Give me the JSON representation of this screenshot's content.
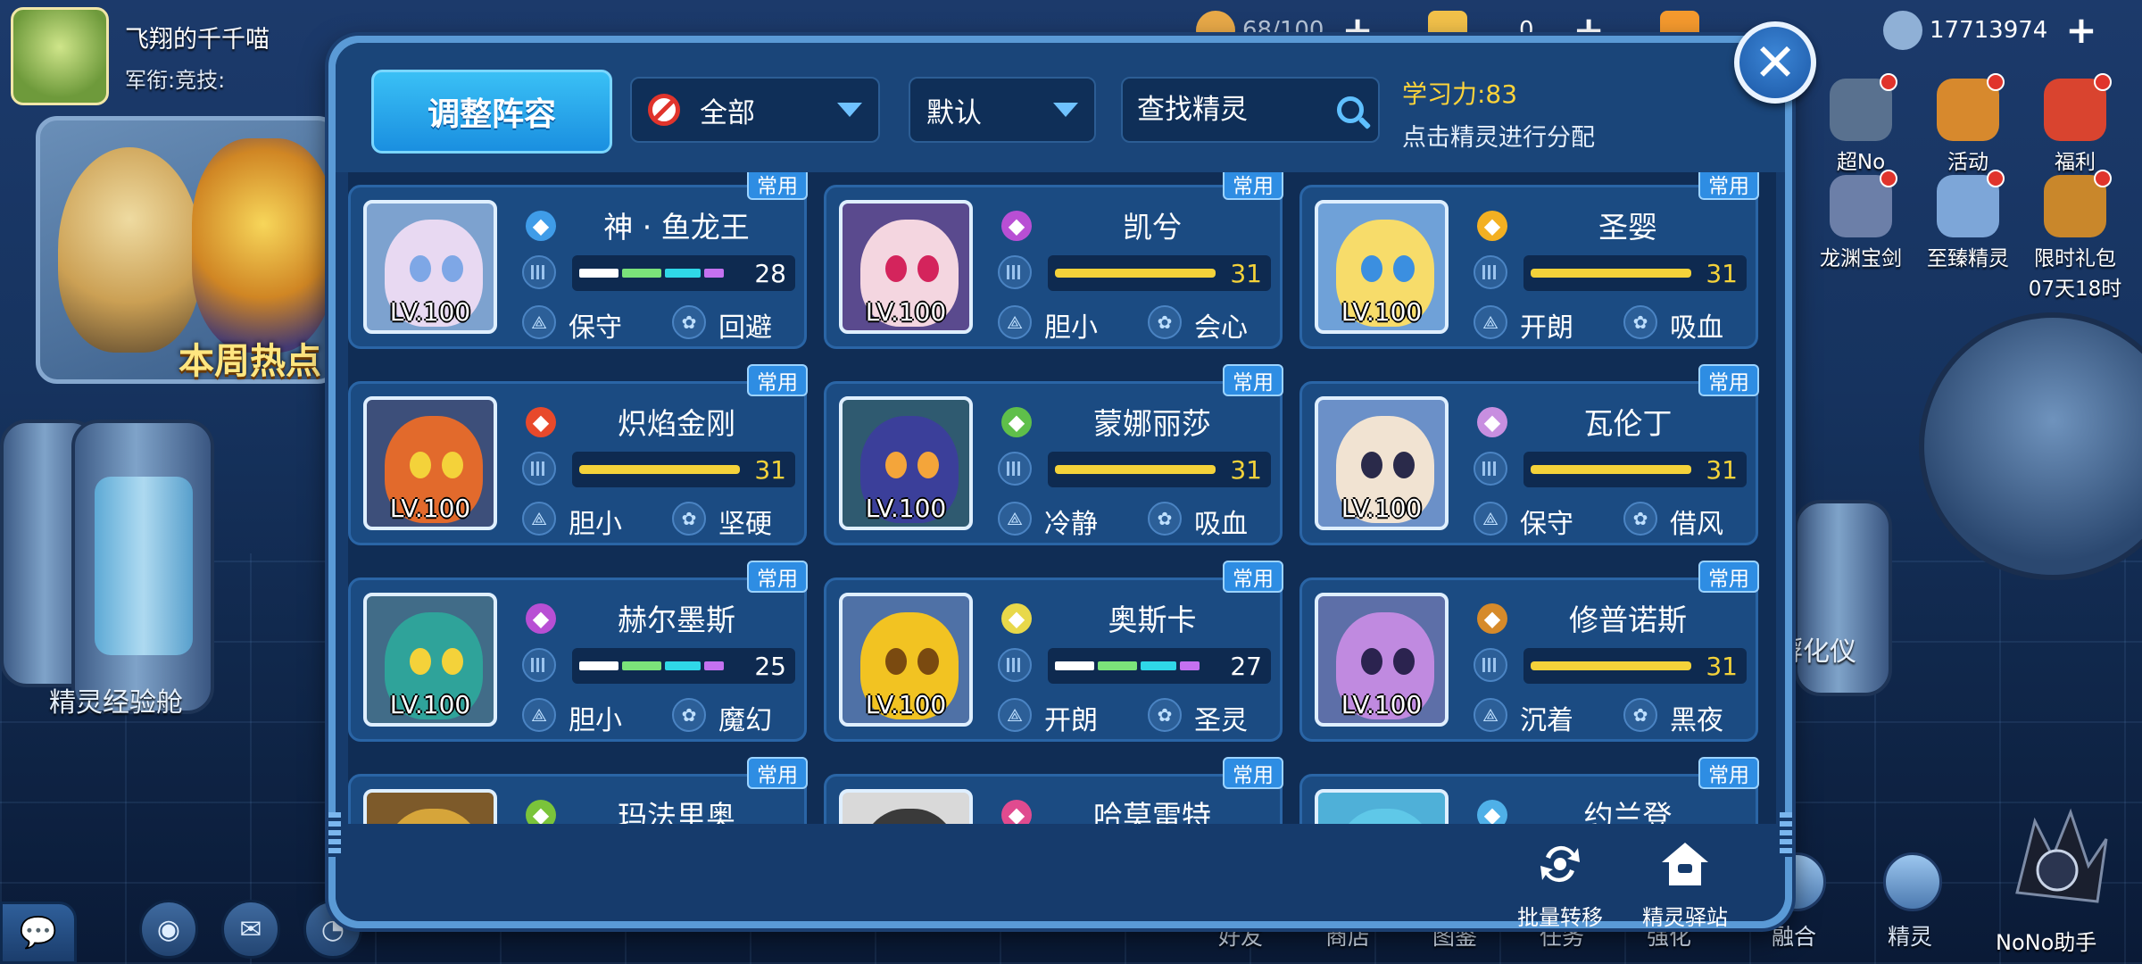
{
  "player": {
    "name": "飞翔的千千喵",
    "sub": "军衔:竞技:"
  },
  "resources": [
    {
      "value": "68/100",
      "color": "#e8a948"
    },
    {
      "value": "0",
      "color": "#f2c14a"
    },
    {
      "value": "",
      "color": "#f59a2e"
    },
    {
      "value": "17713974",
      "color": "#8fb0d6"
    }
  ],
  "background": {
    "hot_label": "本周热点",
    "exp_label": "精灵经验舱",
    "hatch_label": "孵化仪"
  },
  "activities": [
    {
      "label": "超No",
      "icon": "alien-icon",
      "color": "#59718f"
    },
    {
      "label": "活动",
      "icon": "trophy-icon",
      "color": "#d7892d"
    },
    {
      "label": "福利",
      "icon": "gift-icon",
      "color": "#d9442f"
    },
    {
      "label": "龙渊宝剑",
      "icon": "sword-icon",
      "color": "#6c7fa8"
    },
    {
      "label": "至臻精灵",
      "icon": "spirit-icon",
      "color": "#7da6d8"
    },
    {
      "label": "限时礼包",
      "sub": "07天18时",
      "icon": "chest-icon",
      "color": "#c9872b"
    }
  ],
  "bottom_nav": [
    "好友",
    "商店",
    "图鉴",
    "任务",
    "强化",
    "融合",
    "精灵"
  ],
  "nono_label": "NoNo助手",
  "modal": {
    "adjust_label": "调整阵容",
    "filter_label": "全部",
    "sort_label": "默认",
    "search_placeholder": "查找精灵",
    "learn_label": "学习力:83",
    "learn_hint": "点击精灵进行分配",
    "footer": [
      {
        "label": "批量转移",
        "icon": "transfer-icon"
      },
      {
        "label": "精灵驿站",
        "icon": "house-icon"
      }
    ],
    "badge_text": "常用"
  },
  "spirits": [
    {
      "name": "神 · 鱼龙王",
      "lv": "LV.100",
      "value": "28",
      "bar": "multi",
      "val_color": "#ffffff",
      "t1": "保守",
      "t2": "回避",
      "type_color": "#3f9ce8",
      "bg": "#7da2cf",
      "face": "#e8d9f2",
      "eye": "#7ea7e6"
    },
    {
      "name": "凯兮",
      "lv": "LV.100",
      "value": "31",
      "bar": "single",
      "val_color": "#f4d23a",
      "t1": "胆小",
      "t2": "会心",
      "type_color": "#b84fd4",
      "bg": "#5a4a8e",
      "face": "#f4d6e0",
      "eye": "#d4245c"
    },
    {
      "name": "圣婴",
      "lv": "LV.100",
      "value": "31",
      "bar": "single",
      "val_color": "#f4d23a",
      "t1": "开朗",
      "t2": "吸血",
      "type_color": "#f3b022",
      "bg": "#6fa1d8",
      "face": "#f7dc6a",
      "eye": "#3b8fe0"
    },
    {
      "name": "炽焰金刚",
      "lv": "LV.100",
      "value": "31",
      "bar": "single",
      "val_color": "#f4d23a",
      "t1": "胆小",
      "t2": "坚硬",
      "type_color": "#e8492b",
      "bg": "#3d4f7a",
      "face": "#e26a2c",
      "eye": "#f4d23a"
    },
    {
      "name": "蒙娜丽莎",
      "lv": "LV.100",
      "value": "31",
      "bar": "single",
      "val_color": "#f4d23a",
      "t1": "冷静",
      "t2": "吸血",
      "type_color": "#5fbf4a",
      "bg": "#2f5a70",
      "face": "#3b3f9a",
      "eye": "#f4a53a"
    },
    {
      "name": "瓦伦丁",
      "lv": "LV.100",
      "value": "31",
      "bar": "single",
      "val_color": "#f4d23a",
      "t1": "保守",
      "t2": "借风",
      "type_color": "#c88fe0",
      "bg": "#6b90c8",
      "face": "#f1e3d2",
      "eye": "#2a2a4a"
    },
    {
      "name": "赫尔墨斯",
      "lv": "LV.100",
      "value": "25",
      "bar": "multi",
      "val_color": "#ffffff",
      "t1": "胆小",
      "t2": "魔幻",
      "type_color": "#b84fd4",
      "bg": "#416c88",
      "face": "#2fa39a",
      "eye": "#f4d23a"
    },
    {
      "name": "奥斯卡",
      "lv": "LV.100",
      "value": "27",
      "bar": "multi",
      "val_color": "#ffffff",
      "t1": "开朗",
      "t2": "圣灵",
      "type_color": "#e8d84a",
      "bg": "#4f71a6",
      "face": "#f2c322",
      "eye": "#7a4a10"
    },
    {
      "name": "修普诺斯",
      "lv": "LV.100",
      "value": "31",
      "bar": "single",
      "val_color": "#f4d23a",
      "t1": "沉着",
      "t2": "黑夜",
      "type_color": "#d68a2a",
      "bg": "#5d6fa8",
      "face": "#c08ae0",
      "eye": "#2b234f"
    },
    {
      "name": "玛法里奥",
      "lv": "",
      "value": "",
      "bar": "none",
      "val_color": "#ffffff",
      "t1": "",
      "t2": "",
      "type_color": "#7ac43a",
      "bg": "#7d5a2a",
      "face": "#d6a53a",
      "eye": "#000000"
    },
    {
      "name": "哈莫雷特",
      "lv": "",
      "value": "",
      "bar": "none",
      "val_color": "#ffffff",
      "t1": "",
      "t2": "",
      "type_color": "#e04b8f",
      "bg": "#d9d9d9",
      "face": "#3a3a3a",
      "eye": "#000000"
    },
    {
      "name": "约兰登",
      "lv": "",
      "value": "",
      "bar": "none",
      "val_color": "#ffffff",
      "t1": "",
      "t2": "",
      "type_color": "#4fb0e8",
      "bg": "#4fb0d8",
      "face": "#5fc8e8",
      "eye": "#000000"
    }
  ]
}
